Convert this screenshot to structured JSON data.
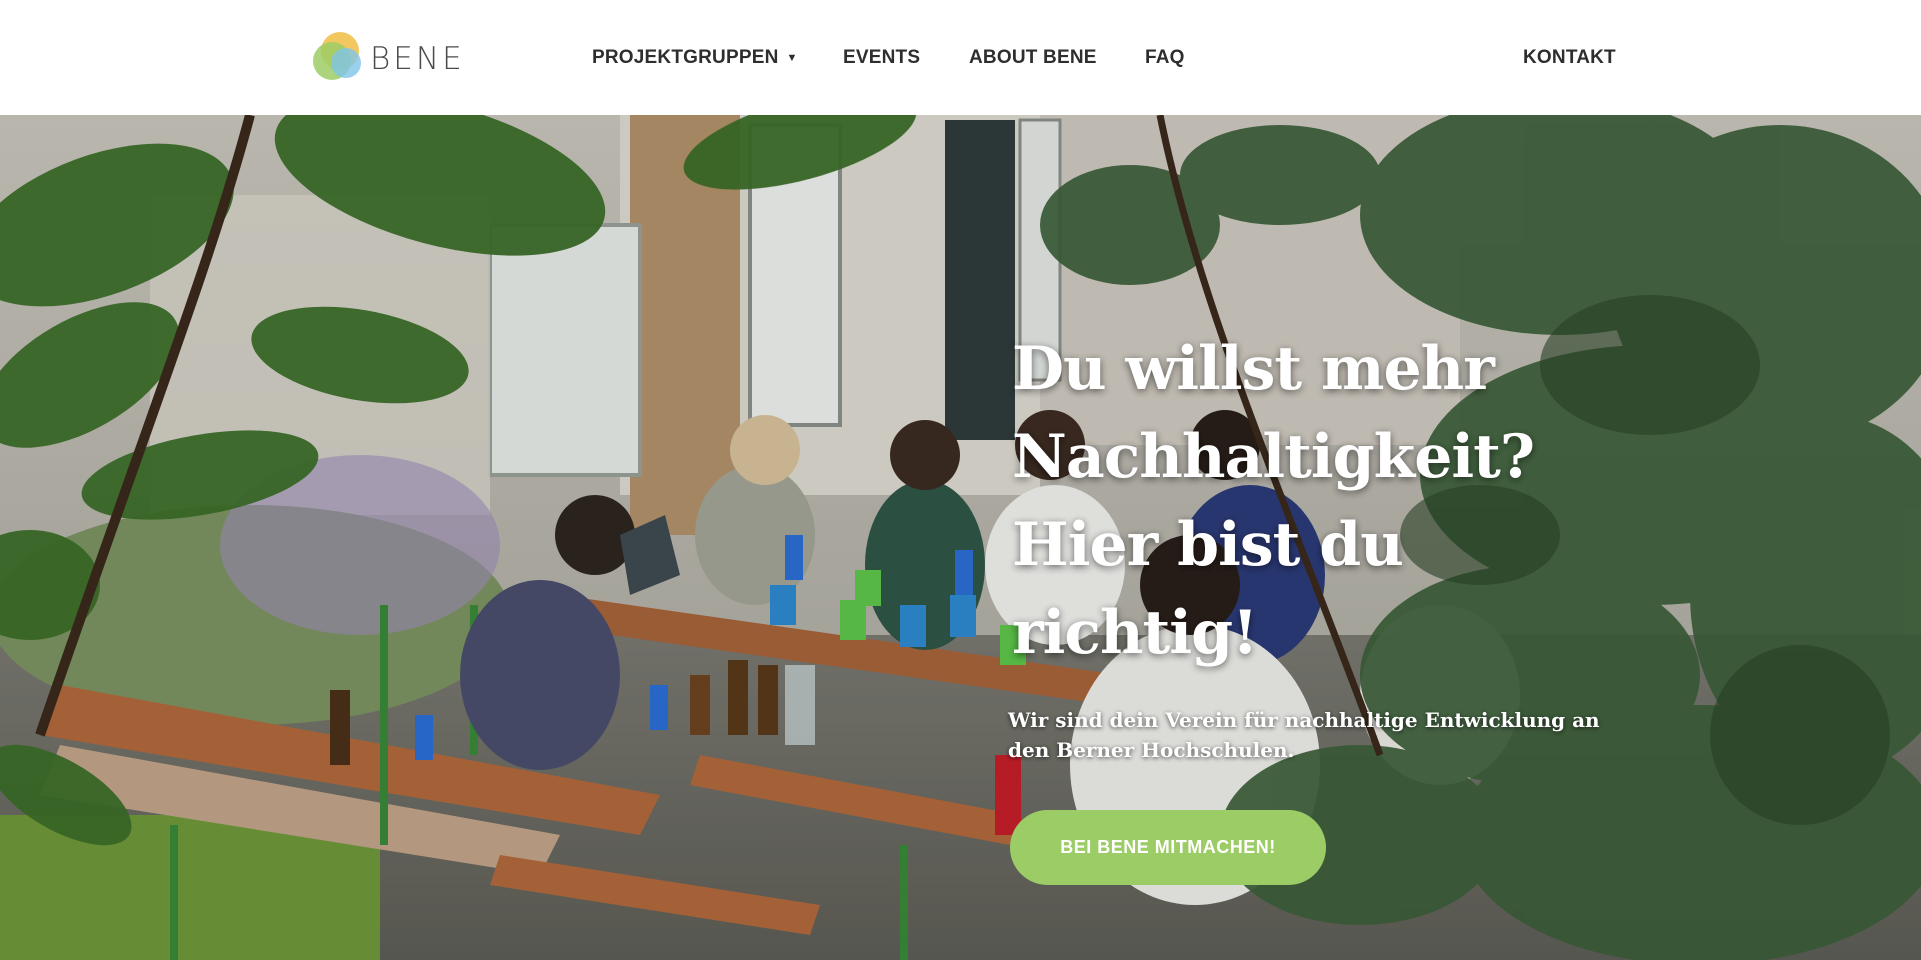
{
  "header": {
    "logo_text": "BENE",
    "nav": [
      {
        "label": "PROJEKTGRUPPEN",
        "has_dropdown": true
      },
      {
        "label": "EVENTS"
      },
      {
        "label": "ABOUT BENE"
      },
      {
        "label": "FAQ"
      }
    ],
    "contact_label": "KONTAKT"
  },
  "hero": {
    "title": "Du willst mehr Nachhaltigkeit? Hier bist du richtig!",
    "subtitle": "Wir sind dein Verein für nachhaltige Entwicklung an den Berner Hochschulen.",
    "cta_label": "BEI BENE MITMACHEN!"
  },
  "colors": {
    "cta": "#9ccc65",
    "nav_text": "#2e2e2e",
    "logo_yellow": "#f2c14e",
    "logo_green": "#9ccc65",
    "logo_blue": "#7fc4e8"
  },
  "icons": {
    "logo": "bene-logo-icon",
    "dropdown": "caret-down-icon"
  }
}
